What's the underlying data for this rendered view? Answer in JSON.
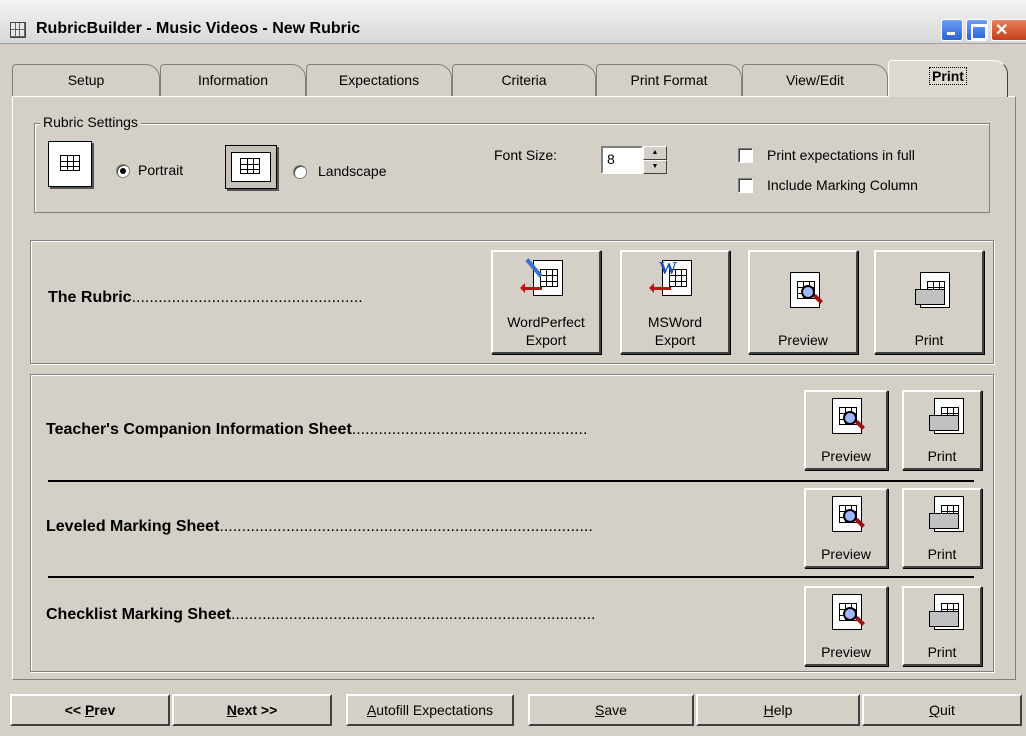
{
  "window": {
    "title": "RubricBuilder  - Music Videos - New Rubric"
  },
  "tabs": [
    {
      "label": "Setup"
    },
    {
      "label": "Information"
    },
    {
      "label": "Expectations"
    },
    {
      "label": "Criteria"
    },
    {
      "label": "Print Format"
    },
    {
      "label": "View/Edit"
    },
    {
      "label": "Print",
      "active": true
    }
  ],
  "settings": {
    "legend": "Rubric Settings",
    "portrait_label": "Portrait",
    "portrait_selected": true,
    "landscape_label": "Landscape",
    "landscape_selected": false,
    "font_size_label": "Font Size:",
    "font_size_value": "8",
    "print_full_label": "Print expectations in full",
    "print_full_checked": false,
    "marking_column_label": "Include Marking Column",
    "marking_column_checked": false
  },
  "rubric_row": {
    "label": "The Rubric",
    "dots": "....................................................",
    "wp_export_line1": "WordPerfect",
    "wp_export_line2": "Export",
    "msword_export_line1": "MSWord",
    "msword_export_line2": "Export",
    "preview_label": "Preview",
    "print_label": "Print"
  },
  "sheets": [
    {
      "label": "Teacher's Companion Information Sheet",
      "dots": ".....................................................",
      "preview_label": "Preview",
      "print_label": "Print"
    },
    {
      "label": "Leveled Marking Sheet",
      "dots": "....................................................................................",
      "preview_label": "Preview",
      "print_label": "Print"
    },
    {
      "label": "Checklist Marking Sheet",
      "dots": "..................................................................................",
      "preview_label": "Preview",
      "print_label": "Print"
    }
  ],
  "bottom_bar": {
    "prev": {
      "pre": "<< ",
      "key": "P",
      "rest": "rev"
    },
    "next": {
      "key": "N",
      "rest": "ext >>"
    },
    "autofill": {
      "key": "A",
      "rest": "utofill Expectations"
    },
    "save": {
      "key": "S",
      "rest": "ave"
    },
    "help": {
      "key": "H",
      "rest": "elp"
    },
    "quit": {
      "key": "Q",
      "rest": "uit"
    }
  }
}
